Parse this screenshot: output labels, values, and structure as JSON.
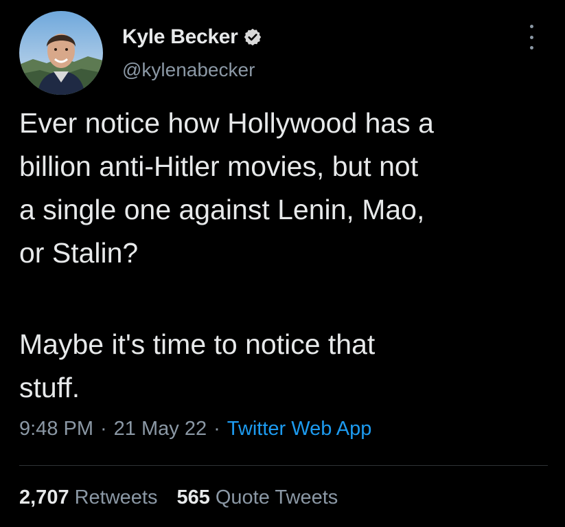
{
  "author": {
    "display_name": "Kyle Becker",
    "handle": "@kylenabecker",
    "verified_icon": "verified-badge-icon"
  },
  "tweet": {
    "paragraph_1": "Ever notice how Hollywood has a\nbillion anti-Hitler movies, but not\na single one against Lenin, Mao,\nor Stalin?",
    "paragraph_2": "Maybe it's time to notice that\nstuff.",
    "time": "9:48 PM",
    "date": "21 May 22",
    "separator": "·",
    "source": "Twitter Web App"
  },
  "stats": {
    "retweets_count": "2,707",
    "retweets_label": "Retweets",
    "quotes_count": "565",
    "quotes_label": "Quote Tweets"
  },
  "colors": {
    "background": "#000000",
    "primary_text": "#e7e9ea",
    "secondary_text": "#8b98a5",
    "link": "#1d9bf0",
    "divider": "#2f3336"
  }
}
